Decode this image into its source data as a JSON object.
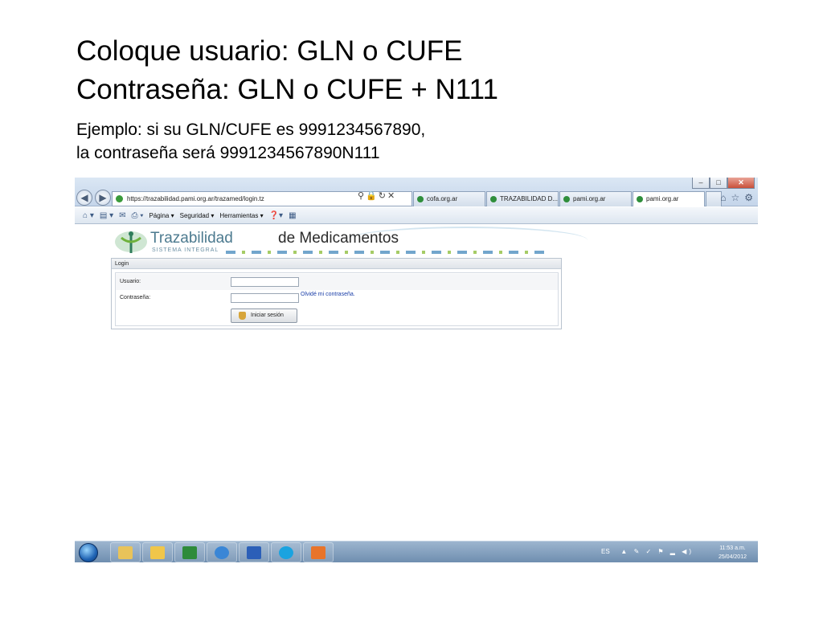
{
  "slide": {
    "title_line1": "Coloque usuario: GLN o CUFE",
    "title_line2": "Contraseña: GLN o CUFE + N111",
    "example_line1": "Ejemplo: si su GLN/CUFE es 9991234567890,",
    "example_line2": "la contraseña será 9991234567890N111"
  },
  "browser": {
    "url": "https://trazabilidad.pami.org.ar/trazamed/login.tz",
    "tabs": [
      {
        "label": "cofa.org.ar"
      },
      {
        "label": "TRAZABILIDAD D..."
      },
      {
        "label": "pami.org.ar"
      },
      {
        "label": "pami.org.ar"
      }
    ],
    "window_buttons": {
      "minimize": "–",
      "maximize": "□",
      "close": "✕"
    },
    "commandbar": {
      "page": "Página ▾",
      "safety": "Seguridad ▾",
      "tools": "Herramientas ▾"
    }
  },
  "site": {
    "logo_main": "Trazabilidad",
    "logo_rest": "de Medicamentos",
    "logo_sub": "SISTEMA INTEGRAL",
    "colors": {
      "logo_blue": "#4c7a8f",
      "link": "#1a3ea8"
    }
  },
  "login": {
    "header": "Login",
    "user_label": "Usuario:",
    "password_label": "Contraseña:",
    "forgot": "Olvidé mi contraseña.",
    "submit": "Iniciar sesión"
  },
  "taskbar": {
    "lang": "ES",
    "time": "11:53 a.m.",
    "date": "25/04/2012"
  }
}
